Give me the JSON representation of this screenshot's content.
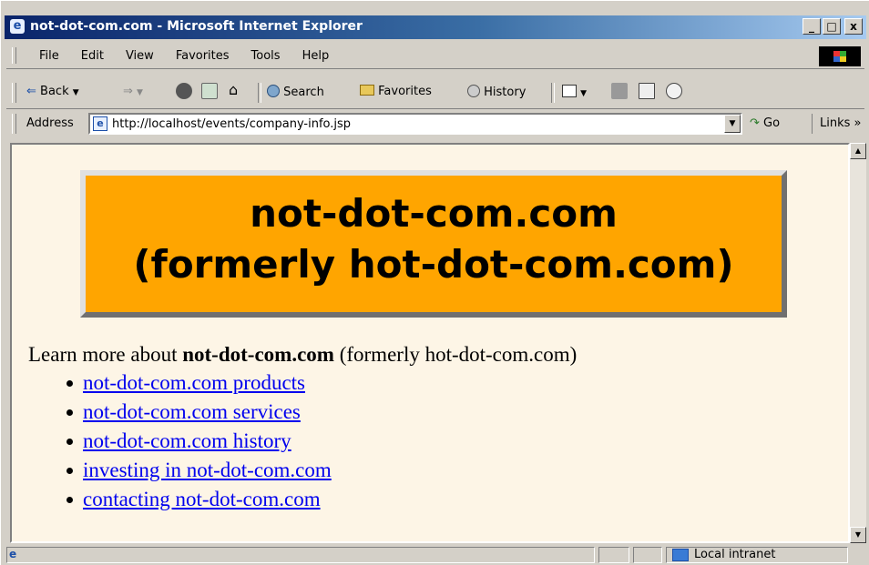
{
  "window": {
    "title": "not-dot-com.com - Microsoft Internet Explorer",
    "controls": {
      "minimize": "_",
      "maximize": "□",
      "close": "x"
    }
  },
  "menu": [
    "File",
    "Edit",
    "View",
    "Favorites",
    "Tools",
    "Help"
  ],
  "toolbar": {
    "back": "Back",
    "search": "Search",
    "favorites": "Favorites",
    "history": "History"
  },
  "address": {
    "label": "Address",
    "url": "http://localhost/events/company-info.jsp",
    "go": "Go",
    "links": "Links »"
  },
  "page": {
    "banner_line1": "not-dot-com.com",
    "banner_line2": "(formerly hot-dot-com.com)",
    "intro_prefix": "Learn more about ",
    "intro_bold": "not-dot-com.com",
    "intro_suffix": " (formerly hot-dot-com.com)",
    "links": [
      "not-dot-com.com products",
      "not-dot-com.com services",
      "not-dot-com.com history",
      "investing in not-dot-com.com",
      "contacting not-dot-com.com"
    ],
    "banner_color": "#ffa500",
    "background_color": "#fdf5e6",
    "link_color": "#0000ee"
  },
  "status": {
    "zone": "Local intranet"
  }
}
